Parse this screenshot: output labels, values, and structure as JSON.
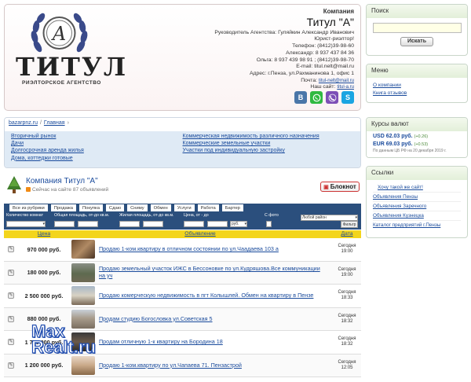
{
  "header": {
    "logo_title": "ТИТУЛ",
    "logo_subtitle": "РИЭЛТОРСКОЕ АГЕНТСТВО",
    "company_label": "Компания",
    "company_name": "Титул \"А\"",
    "lines": [
      "Руководитель Агентства: Гуляйкин Александр Иванович",
      "Юрист-риэлтор!",
      "Телефон: (8412)39-98-60",
      "Александр: 8 937 437 84 36",
      "Ольга: 8 937 439 98 91 ; (8412)39-98-70",
      "E-mail: titul.nelt@mail.ru",
      "Адрес: г.Пенза, ул.Рахманинова 1, офис 1"
    ],
    "mail_label": "Почта:",
    "mail_value": "titul-nelt@mail.ru",
    "site_label": "Наш сайт:",
    "site_value": "titul-a.ru",
    "social_icons": [
      "vk-icon",
      "whatsapp-icon",
      "viber-icon",
      "skype-icon"
    ]
  },
  "breadcrumb": {
    "items": [
      "bazarpnz.ru",
      "Главная"
    ]
  },
  "categories": {
    "left": [
      "Вторичный рынок",
      "Дачи",
      "Долгосрочная аренда жилья",
      "Дома, коттеджи готовые"
    ],
    "right": [
      "Коммерческая недвижимость различного назначения",
      "Коммерческие земельные участки",
      "Участки под индивидуальную застройку"
    ]
  },
  "company": {
    "title": "Компания Титул \"А\"",
    "count": "Сейчас на сайте 87 объявлений",
    "notebook": "Блокнот"
  },
  "tabs": [
    "Все из рубрики",
    "Продажа",
    "Покупка",
    "Сдаю",
    "Сниму",
    "Обмен",
    "Услуги",
    "Работа",
    "Бартер"
  ],
  "filter": {
    "rooms_label": "Количество комнат",
    "total_area_label": "Общая площадь, от-до кв.м.",
    "living_area_label": "Жилая площадь, от-до кв.м.",
    "price_label": "Цена, от - до",
    "photo_label": "С фото",
    "district_placeholder": "Любой район",
    "currency": "руб.",
    "button": "Фильтр"
  },
  "table": {
    "col_price": "Цена",
    "col_title": "Объявление",
    "col_date": "Дата",
    "rows": [
      {
        "price": "970 000 руб.",
        "title": "Продаю 1-ком.квартиру в отличном состоянии по ул.Чаадаева 103 а",
        "day": "Сегодня",
        "time": "19:00"
      },
      {
        "price": "180 000 руб.",
        "title": "Продаю земельный участок ИЖС в Бессоновке по ул.Кудряшова.Все коммуникации на уч",
        "day": "Сегодня",
        "time": "19:00"
      },
      {
        "price": "2 500 000 руб.",
        "title": "Продаю комерческую недвижимость в пгт Колышлей. Обмен на квартиру в Пензе",
        "day": "Сегодня",
        "time": "18:33"
      },
      {
        "price": "880 000 руб.",
        "title": "Продам студию Богословка ул.Советская 5",
        "day": "Сегодня",
        "time": "18:32"
      },
      {
        "price": "1 700 000 руб.",
        "title": "Продам отличную 1-к квартиру на Бородина 18",
        "day": "Сегодня",
        "time": "18:32"
      },
      {
        "price": "1 200 000 руб.",
        "title": "Продаю 1-ком.квартиру по ул.Чапаева 71. Пензастрой",
        "day": "Сегодня",
        "time": "12:05"
      }
    ]
  },
  "sidebar": {
    "search": {
      "title": "Поиск",
      "button": "Искать"
    },
    "menu": {
      "title": "Меню",
      "items": [
        "О компании",
        "Книга отзывов"
      ]
    },
    "rates": {
      "title": "Курсы валют",
      "usd_code": "USD",
      "usd_value": "62.03 руб.",
      "usd_delta": "(+0.26)",
      "eur_code": "EUR",
      "eur_value": "69.03 руб.",
      "eur_delta": "(+0.53)",
      "note": "По данным ЦБ РФ на 20 декабря 2019 г."
    },
    "links": {
      "title": "Ссылки",
      "items": [
        "Хочу такой же сайт!",
        "Объявления Пензы",
        "Объявления Заречного",
        "Объявления Кузнецка",
        "Каталог предприятий г.Пензы"
      ]
    }
  },
  "watermark": {
    "line1": "Max",
    "line2": "Realt.ru"
  },
  "colors": {
    "accent": "#2b4f7d",
    "highlight": "#f3d51c",
    "link": "#1a4b9c",
    "rate_delta": "#4c8a3a"
  }
}
